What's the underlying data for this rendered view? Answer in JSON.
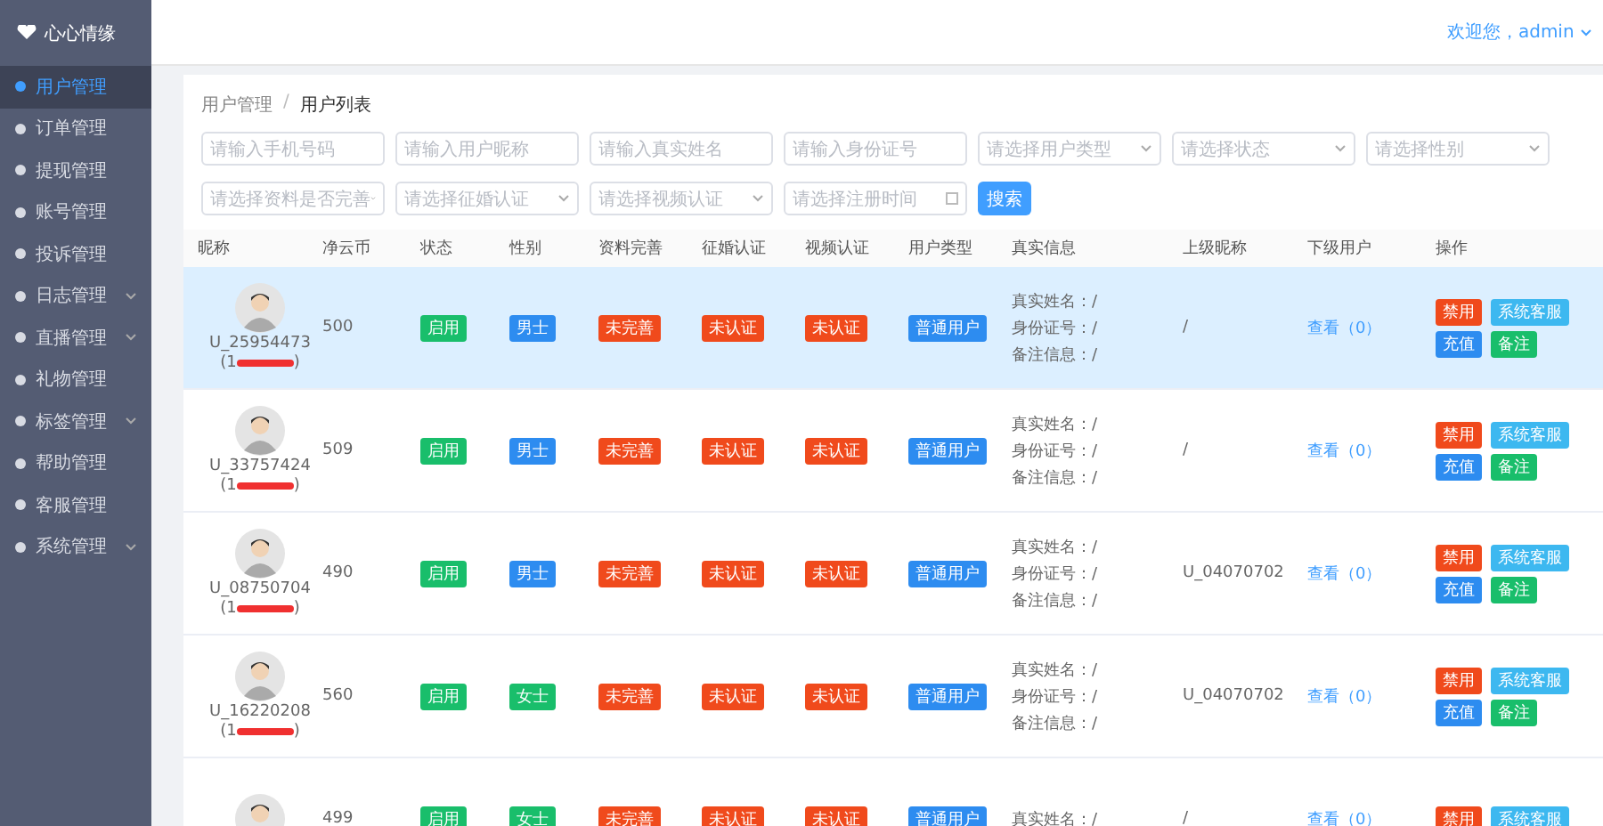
{
  "sidebar": {
    "logo": "心心情缘",
    "items": [
      {
        "label": "用户管理",
        "selected": true,
        "expandable": false
      },
      {
        "label": "订单管理",
        "selected": false,
        "expandable": false
      },
      {
        "label": "提现管理",
        "selected": false,
        "expandable": false
      },
      {
        "label": "账号管理",
        "selected": false,
        "expandable": false
      },
      {
        "label": "投诉管理",
        "selected": false,
        "expandable": false
      },
      {
        "label": "日志管理",
        "selected": false,
        "expandable": true
      },
      {
        "label": "直播管理",
        "selected": false,
        "expandable": true
      },
      {
        "label": "礼物管理",
        "selected": false,
        "expandable": false
      },
      {
        "label": "标签管理",
        "selected": false,
        "expandable": true
      },
      {
        "label": "帮助管理",
        "selected": false,
        "expandable": false
      },
      {
        "label": "客服管理",
        "selected": false,
        "expandable": false
      },
      {
        "label": "系统管理",
        "selected": false,
        "expandable": true
      }
    ]
  },
  "header": {
    "user": "欢迎您，admin"
  },
  "breadcrumb": [
    "用户管理",
    "用户列表"
  ],
  "breadcrumb_separator": "/",
  "filters": [
    {
      "kind": "input",
      "placeholder": "请输入手机号码"
    },
    {
      "kind": "input",
      "placeholder": "请输入用户昵称"
    },
    {
      "kind": "input",
      "placeholder": "请输入真实姓名"
    },
    {
      "kind": "input",
      "placeholder": "请输入身份证号"
    },
    {
      "kind": "select",
      "placeholder": "请选择用户类型"
    },
    {
      "kind": "select",
      "placeholder": "请选择状态"
    },
    {
      "kind": "select",
      "placeholder": "请选择性别"
    },
    {
      "kind": "select",
      "placeholder": "请选择资料是否完善"
    },
    {
      "kind": "select",
      "placeholder": "请选择征婚认证"
    },
    {
      "kind": "select",
      "placeholder": "请选择视频认证"
    },
    {
      "kind": "date",
      "placeholder": "请选择注册时间"
    },
    {
      "kind": "button",
      "label": "搜索"
    }
  ],
  "table": {
    "columns": [
      "昵称",
      "净云币",
      "状态",
      "性别",
      "资料完善",
      "征婚认证",
      "视频认证",
      "用户类型",
      "真实信息",
      "上级昵称",
      "下级用户",
      "操作"
    ],
    "rows": [
      {
        "selected": true,
        "nickname": "U_25954473",
        "phone_start": "(1",
        "phone_end": ")",
        "coins": "500",
        "status": "启用",
        "gender": "男士",
        "profile": "未完善",
        "marriage": "未认证",
        "video": "未认证",
        "type": "普通用户",
        "info": [
          "真实姓名：/",
          "身份证号：/",
          "备注信息：/"
        ],
        "parent": "/",
        "children": "查看（0）",
        "actions": [
          "禁用",
          "系统客服",
          "充值",
          "备注"
        ]
      },
      {
        "selected": false,
        "nickname": "U_33757424",
        "phone_start": "(1",
        "phone_end": ")",
        "coins": "509",
        "status": "启用",
        "gender": "男士",
        "profile": "未完善",
        "marriage": "未认证",
        "video": "未认证",
        "type": "普通用户",
        "info": [
          "真实姓名：/",
          "身份证号：/",
          "备注信息：/"
        ],
        "parent": "/",
        "children": "查看（0）",
        "actions": [
          "禁用",
          "系统客服",
          "充值",
          "备注"
        ]
      },
      {
        "selected": false,
        "nickname": "U_08750704",
        "phone_start": "(1",
        "phone_end": ")",
        "coins": "490",
        "status": "启用",
        "gender": "男士",
        "profile": "未完善",
        "marriage": "未认证",
        "video": "未认证",
        "type": "普通用户",
        "info": [
          "真实姓名：/",
          "身份证号：/",
          "备注信息：/"
        ],
        "parent": "U_04070702",
        "children": "查看（0）",
        "actions": [
          "禁用",
          "系统客服",
          "充值",
          "备注"
        ]
      },
      {
        "selected": false,
        "nickname": "U_16220208",
        "phone_start": "(1",
        "phone_end": ")",
        "coins": "560",
        "status": "启用",
        "gender": "女士",
        "profile": "未完善",
        "marriage": "未认证",
        "video": "未认证",
        "type": "普通用户",
        "info": [
          "真实姓名：/",
          "身份证号：/",
          "备注信息：/"
        ],
        "parent": "U_04070702",
        "children": "查看（0）",
        "actions": [
          "禁用",
          "系统客服",
          "充值",
          "备注"
        ]
      },
      {
        "selected": false,
        "coins": "499",
        "status": "启用",
        "gender": "女士",
        "profile": "未完善",
        "marriage": "未认证",
        "video": "未认证",
        "type": "普通用户",
        "info": [
          "真实姓名：/"
        ],
        "parent": "/",
        "children": "查看（0）",
        "actions": [
          "禁用",
          "系统客服"
        ]
      }
    ]
  }
}
